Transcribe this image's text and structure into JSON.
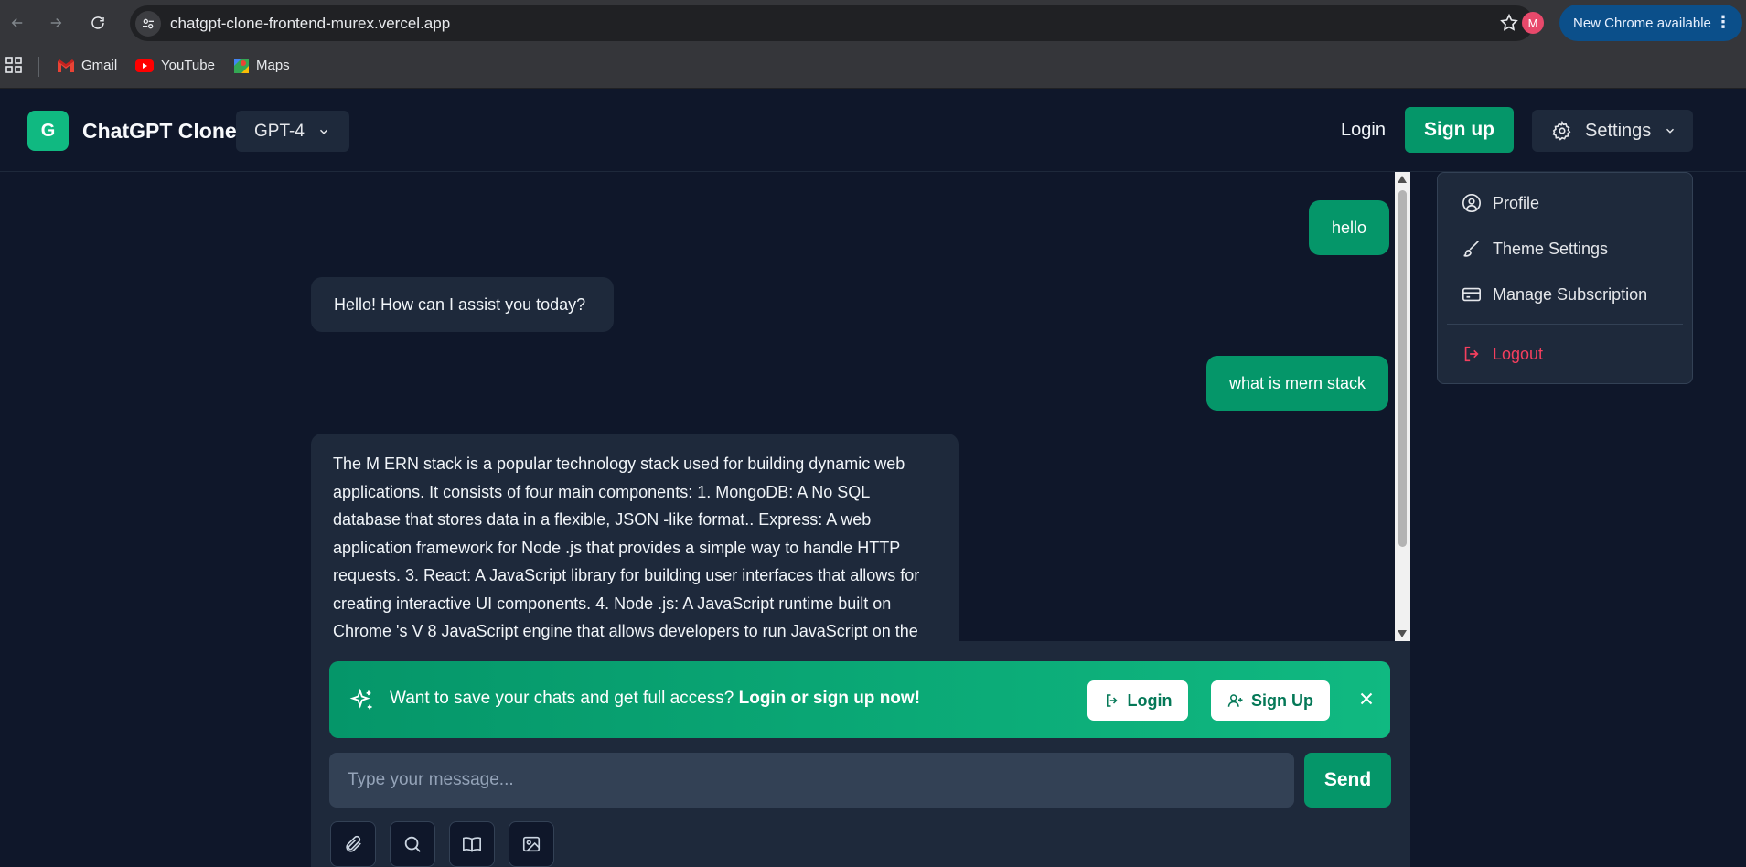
{
  "browser": {
    "url": "chatgpt-clone-frontend-murex.vercel.app",
    "profile_initial": "M",
    "update_label": "New Chrome available",
    "bookmarks": [
      {
        "label": "Gmail",
        "icon": "gmail-icon"
      },
      {
        "label": "YouTube",
        "icon": "youtube-icon"
      },
      {
        "label": "Maps",
        "icon": "maps-icon"
      }
    ]
  },
  "header": {
    "logo_letter": "G",
    "title": "ChatGPT Clone",
    "model": "GPT-4",
    "login_label": "Login",
    "signup_label": "Sign up",
    "settings_label": "Settings"
  },
  "settings_menu": {
    "items": [
      {
        "label": "Profile",
        "icon": "user-circle-icon"
      },
      {
        "label": "Theme Settings",
        "icon": "paintbrush-icon"
      },
      {
        "label": "Manage Subscription",
        "icon": "credit-card-icon"
      }
    ],
    "logout_label": "Logout"
  },
  "messages": [
    {
      "role": "user",
      "text": "hello"
    },
    {
      "role": "assistant",
      "text": "Hello! How can I assist you today?"
    },
    {
      "role": "user",
      "text": "what is mern stack"
    },
    {
      "role": "assistant",
      "text": "The M ERN stack is a popular technology stack used for building dynamic web applications. It consists of four main components: 1. MongoDB: A No SQL database that stores data in a flexible, JSON -like format.. Express: A web application framework for Node .js that provides a simple way to handle HTTP requests. 3. React: A JavaScript library for building user interfaces that allows for creating interactive UI components. 4. Node .js: A JavaScript runtime built on Chrome 's V 8 JavaScript engine that allows developers to run JavaScript on the"
    }
  ],
  "banner": {
    "text": "Want to save your chats and get full access?",
    "emphasis": "Login or sign up now!",
    "login_label": "Login",
    "signup_label": "Sign Up"
  },
  "composer": {
    "placeholder": "Type your message...",
    "send_label": "Send",
    "tools": [
      "paperclip-icon",
      "search-icon",
      "book-icon",
      "image-icon"
    ]
  },
  "colors": {
    "accent": "#059669",
    "background": "#0f172a",
    "panel": "#1e293b",
    "danger": "#f43f5e"
  }
}
